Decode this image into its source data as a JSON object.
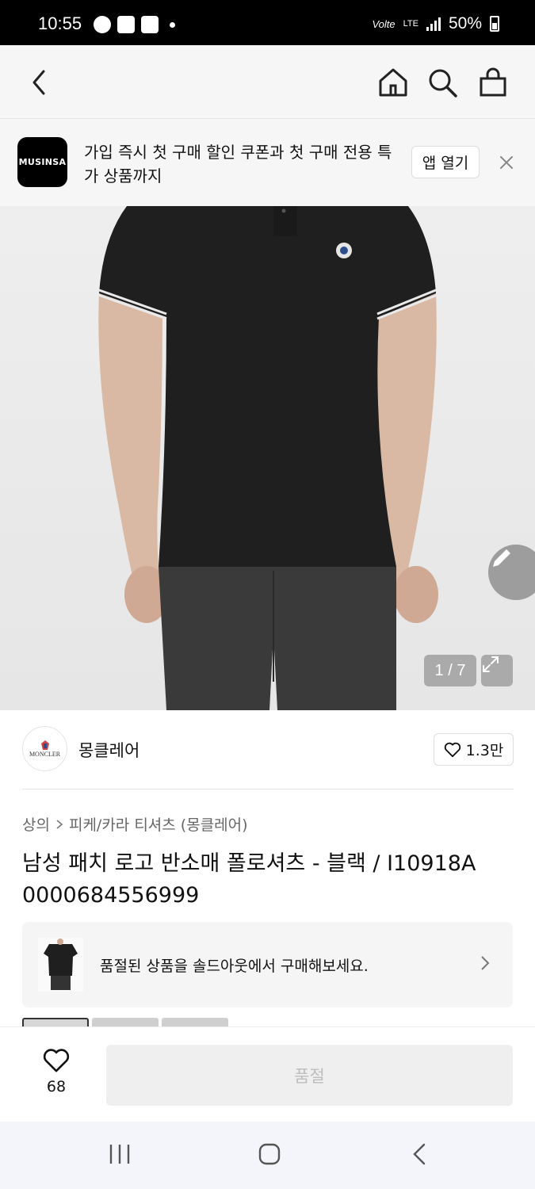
{
  "status_bar": {
    "time": "10:55",
    "volte": "Volte",
    "network": "LTE",
    "battery": "50%"
  },
  "nav": {
    "back_icon": "chevron-left-icon",
    "home_icon": "home-icon",
    "search_icon": "search-icon",
    "cart_icon": "shopping-bag-icon"
  },
  "promo": {
    "logo_text": "MUSINSA",
    "message": "가입 즉시 첫 구매 할인 쿠폰과 첫 구매 전용 특가 상품까지",
    "open_app_label": "앱 열기"
  },
  "gallery": {
    "counter": "1 / 7"
  },
  "brand": {
    "logo_text": "MONCLER",
    "name": "몽클레어",
    "likes": "1.3만"
  },
  "breadcrumb": {
    "category": "상의",
    "subcategory": "피케/카라 티셔츠 (몽클레어)"
  },
  "product": {
    "title": "남성 패치 로고 반소매 폴로셔츠 - 블랙 / I10918A 0000684556999"
  },
  "soldout_notice": {
    "text": "품절된 상품을 솔드아웃에서 구매해보세요."
  },
  "bottom_bar": {
    "wish_count": "68",
    "buy_label": "품절"
  },
  "colors": {
    "accent": "#000000",
    "disabled_button": "#efefef",
    "disabled_text": "#bdbdbd"
  }
}
